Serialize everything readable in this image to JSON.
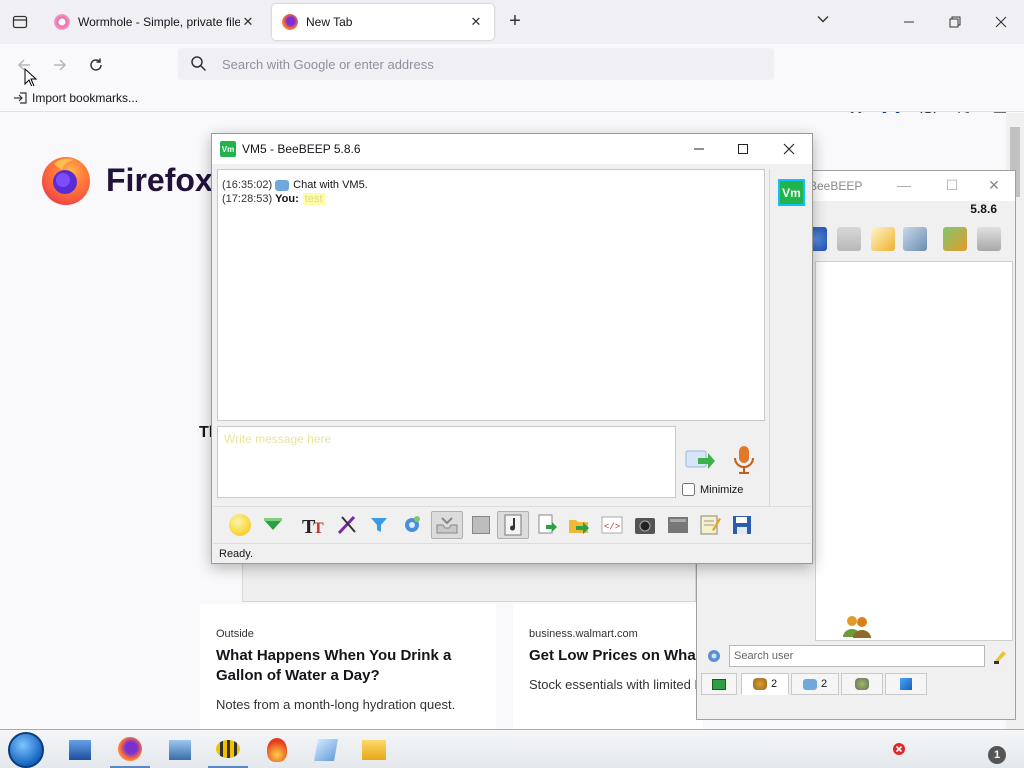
{
  "browser": {
    "tabs": [
      {
        "title": "Wormhole - Simple, private file",
        "active": false,
        "favicon_color": "#e86aa8"
      },
      {
        "title": "New Tab",
        "active": true,
        "favicon_color": "#e8562a"
      }
    ],
    "new_tab_symbol": "+",
    "close_symbol": "✕",
    "address_placeholder": "Search with Google or enter address",
    "bookmarks": [
      {
        "label": "Import bookmarks..."
      }
    ]
  },
  "newtab": {
    "brand": "Firefox",
    "section_title": "Th",
    "cards": [
      {
        "source": "Outside",
        "headline": "What Happens When You Drink a Gallon of Water a Day?",
        "desc": "Notes from a month-long hydration quest."
      },
      {
        "source": "business.walmart.com",
        "headline": "Get Low Prices on What Y",
        "desc": "Stock essentials with limited Deals from Walmart Busine"
      }
    ]
  },
  "chat_window": {
    "badge": "Vm",
    "title": "VM5 - BeeBEEP 5.8.6",
    "messages": [
      {
        "time": "(16:35:02)",
        "type": "system",
        "text": "Chat with VM5."
      },
      {
        "time": "(17:28:53)",
        "type": "user",
        "sender": "You:",
        "text": "test"
      }
    ],
    "compose_placeholder": "Write message here",
    "minimize_label": "Minimize",
    "status": "Ready.",
    "avatar_text": "Vm"
  },
  "main_window": {
    "title": "BeeBEEP",
    "version": "5.8.6",
    "search_placeholder": "Search user",
    "tabs": [
      {
        "icon": "computer-icon",
        "count": ""
      },
      {
        "icon": "users-icon",
        "count": "2"
      },
      {
        "icon": "chats-icon",
        "count": "2"
      },
      {
        "icon": "groups-icon",
        "count": ""
      },
      {
        "icon": "flag-icon",
        "count": ""
      }
    ]
  },
  "taskbar": {
    "notification_count": "1"
  },
  "colors": {
    "accent": "#0060df",
    "beebeep_green": "#22b34a",
    "highlight_yellow": "#ffffa8"
  }
}
